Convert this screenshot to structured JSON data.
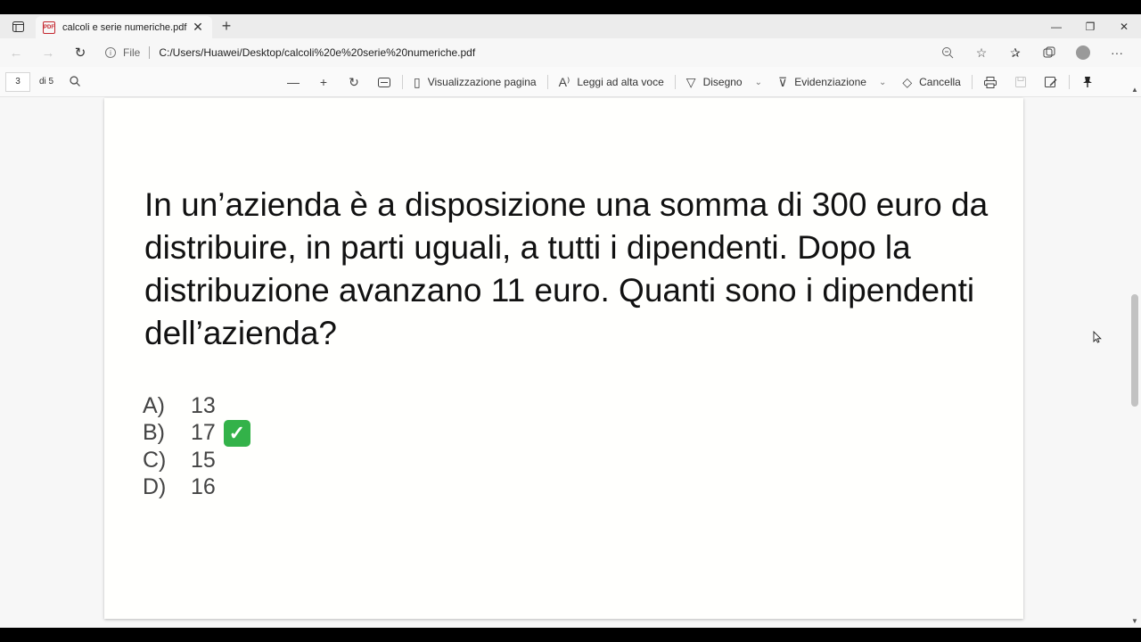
{
  "tab": {
    "title": "calcoli e serie numeriche.pdf",
    "badge": "PDF",
    "close": "✕",
    "new": "+"
  },
  "window": {
    "minimize": "—",
    "restore": "❐",
    "close": "✕"
  },
  "address": {
    "site_label": "File",
    "url": "C:/Users/Huawei/Desktop/calcoli%20e%20serie%20numeriche.pdf"
  },
  "toolbar": {
    "page_current": "3",
    "page_total": "di 5",
    "page_view_label": "Visualizzazione pagina",
    "read_aloud_label": "Leggi ad alta voce",
    "draw_label": "Disegno",
    "highlight_label": "Evidenziazione",
    "erase_label": "Cancella"
  },
  "document": {
    "question": "In un’azienda è a disposizione una somma di 300 euro da distribuire, in parti uguali, a tutti i dipendenti. Dopo la distribuzione avanzano 11 euro. Quanti sono i dipendenti dell’azienda?",
    "options": [
      {
        "letter": "A)",
        "value": "13"
      },
      {
        "letter": "B)",
        "value": "17"
      },
      {
        "letter": "C)",
        "value": "15"
      },
      {
        "letter": "D)",
        "value": "16"
      }
    ],
    "correct_mark": "✓"
  },
  "colors": {
    "check_green": "#33b249",
    "pdf_red": "#c4262e"
  }
}
